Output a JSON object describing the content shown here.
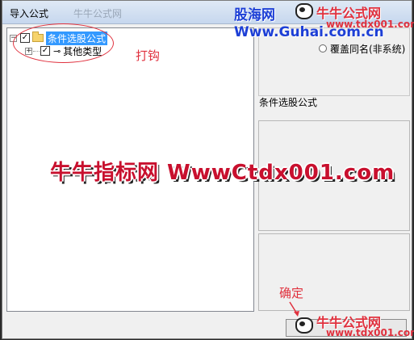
{
  "window": {
    "title": "导入公式",
    "ghost_title": "牛牛公式网"
  },
  "tree": {
    "root": {
      "label": "条件选股公式",
      "checked": true,
      "selected": true
    },
    "child": {
      "label": "其他类型",
      "checked": true
    }
  },
  "annotations": {
    "check_note": "打钩",
    "confirm_note": "确定"
  },
  "options": {
    "overwrite_label": "覆盖同名(非系统)"
  },
  "section": {
    "label": "条件选股公式"
  },
  "watermarks": {
    "logo_top": "股海网",
    "url_top": "Www.Guhai.com.cn",
    "niu_top": "牛牛公式网",
    "niu_top_url": "www.tdx001.com",
    "niu_bottom": "牛牛公式网",
    "niu_bottom_url": "www.tdx001.com",
    "center": "牛牛指标网 WwwCtdx001.com"
  },
  "colors": {
    "accent_red": "#e0313e",
    "selection": "#3399ff",
    "watermark_blue": "#1d3fd6"
  }
}
